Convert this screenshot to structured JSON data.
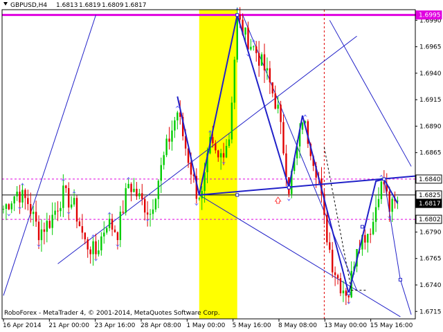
{
  "header": {
    "symbol": "GBPUSD,H4",
    "open": "1.6813",
    "high": "1.6819",
    "low": "1.6809",
    "close": "1.6817"
  },
  "footer": {
    "copyright": "RoboForex - MetaTrader 4, © 2001-2014, MetaQuotes Software Corp."
  },
  "colors": {
    "bull_candle": "#00cc00",
    "bear_candle": "#e00000",
    "wave_line": "#2020c8",
    "channel_line": "#2020c8",
    "level_line": "#e000e0",
    "highlight_zone": "#ffff00",
    "current_price_line": "#000000",
    "fractal_arrow": "#6060ff"
  },
  "chart_data": {
    "type": "candlestick",
    "title": "GBPUSD,H4",
    "x_tick_labels": [
      "16 Apr 2014",
      "21 Apr 00:00",
      "23 Apr 16:00",
      "28 Apr 08:00",
      "1 May 00:00",
      "5 May 16:00",
      "8 May 08:00",
      "13 May 00:00",
      "15 May 16:00"
    ],
    "y_tick_labels": [
      "1.6990",
      "1.6965",
      "1.6940",
      "1.6915",
      "1.6890",
      "1.6865",
      "1.6840",
      "1.6815",
      "1.6790",
      "1.6765",
      "1.6740",
      "1.6715"
    ],
    "ylim": [
      1.6708,
      1.7
    ],
    "grid": false,
    "price_labels": [
      {
        "value": 1.6995,
        "text": "1.6995",
        "style": "magenta"
      },
      {
        "value": 1.684,
        "text": "1.6840",
        "style": "white"
      },
      {
        "value": 1.6825,
        "text": "1.6825",
        "style": "white"
      },
      {
        "value": 1.6817,
        "text": "1.6817",
        "style": "black"
      },
      {
        "value": 1.6802,
        "text": "1.6802",
        "style": "white"
      }
    ],
    "horizontal_levels": [
      {
        "value": 1.6995,
        "style": "solid-magenta"
      },
      {
        "value": 1.684,
        "style": "dashed-magenta"
      },
      {
        "value": 1.6802,
        "style": "dashed-magenta"
      },
      {
        "value": 1.6825,
        "style": "solid-black"
      }
    ],
    "vertical_dashed_at_index": 118,
    "highlight_index_range": [
      72,
      86
    ],
    "anchors": [
      [
        0,
        1.6812
      ],
      [
        5,
        1.6828
      ],
      [
        9,
        1.6818
      ],
      [
        13,
        1.679
      ],
      [
        17,
        1.68
      ],
      [
        22,
        1.6826
      ],
      [
        26,
        1.6814
      ],
      [
        30,
        1.678
      ],
      [
        34,
        1.677
      ],
      [
        38,
        1.68
      ],
      [
        42,
        1.679
      ],
      [
        46,
        1.6836
      ],
      [
        50,
        1.6822
      ],
      [
        54,
        1.6808
      ],
      [
        57,
        1.684
      ],
      [
        60,
        1.687
      ],
      [
        64,
        1.6904
      ],
      [
        67,
        1.687
      ],
      [
        71,
        1.6828
      ],
      [
        73,
        1.6824
      ],
      [
        76,
        1.6872
      ],
      [
        79,
        1.6858
      ],
      [
        83,
        1.688
      ],
      [
        86,
        1.6992
      ],
      [
        89,
        1.6975
      ],
      [
        93,
        1.696
      ],
      [
        97,
        1.6938
      ],
      [
        101,
        1.6905
      ],
      [
        105,
        1.6832
      ],
      [
        109,
        1.688
      ],
      [
        110,
        1.6898
      ],
      [
        113,
        1.687
      ],
      [
        116,
        1.684
      ],
      [
        118,
        1.68
      ],
      [
        121,
        1.676
      ],
      [
        124,
        1.674
      ],
      [
        127,
        1.6732
      ],
      [
        130,
        1.678
      ],
      [
        134,
        1.679
      ],
      [
        136,
        1.68
      ],
      [
        138,
        1.683
      ],
      [
        140,
        1.6836
      ],
      [
        142,
        1.6812
      ],
      [
        145,
        1.6817
      ]
    ]
  }
}
